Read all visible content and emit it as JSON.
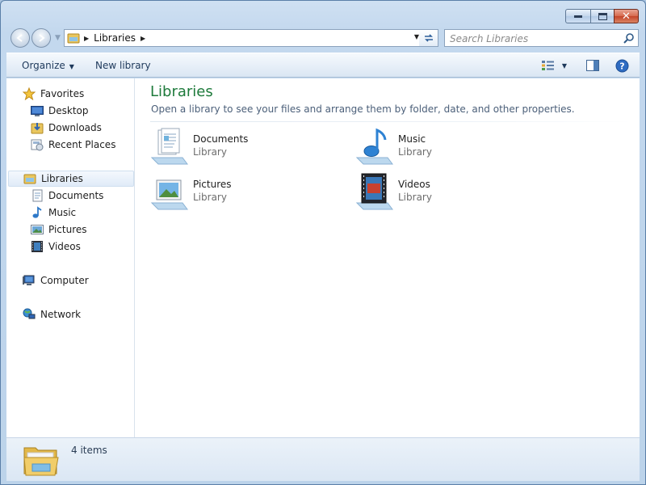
{
  "window": {
    "caption_buttons": {
      "minimize_glyph": "▁",
      "maximize_glyph": "□",
      "close_glyph": "✕"
    }
  },
  "address_bar": {
    "crumbs": [
      "Libraries"
    ],
    "search_placeholder": "Search Libraries"
  },
  "toolbar": {
    "organize_label": "Organize",
    "new_library_label": "New library"
  },
  "navigation": {
    "favorites": {
      "label": "Favorites",
      "items": [
        {
          "label": "Desktop",
          "icon": "desktop-icon"
        },
        {
          "label": "Downloads",
          "icon": "downloads-icon"
        },
        {
          "label": "Recent Places",
          "icon": "recent-places-icon"
        }
      ]
    },
    "libraries": {
      "label": "Libraries",
      "items": [
        {
          "label": "Documents",
          "icon": "documents-icon"
        },
        {
          "label": "Music",
          "icon": "music-icon"
        },
        {
          "label": "Pictures",
          "icon": "pictures-icon"
        },
        {
          "label": "Videos",
          "icon": "videos-icon"
        }
      ]
    },
    "computer": {
      "label": "Computer"
    },
    "network": {
      "label": "Network"
    }
  },
  "main": {
    "title": "Libraries",
    "description": "Open a library to see your files and arrange them by folder, date, and other properties.",
    "items": [
      {
        "name": "Documents",
        "type": "Library",
        "icon": "documents-library-icon"
      },
      {
        "name": "Music",
        "type": "Library",
        "icon": "music-library-icon"
      },
      {
        "name": "Pictures",
        "type": "Library",
        "icon": "pictures-library-icon"
      },
      {
        "name": "Videos",
        "type": "Library",
        "icon": "videos-library-icon"
      }
    ]
  },
  "status": {
    "count_text": "4 items"
  },
  "colors": {
    "title_green": "#1e7a3b",
    "toolbar_text": "#1e395b",
    "close_red": "#c4442a"
  }
}
